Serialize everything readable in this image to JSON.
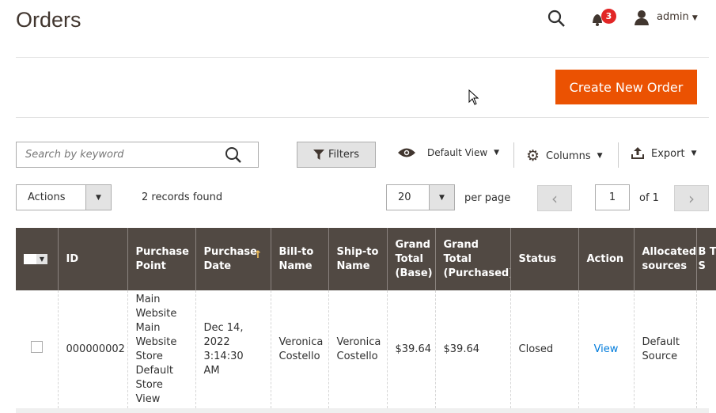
{
  "header": {
    "title": "Orders",
    "notifications_count": "3",
    "user": "admin"
  },
  "actions": {
    "create_order": "Create New Order"
  },
  "toolbar": {
    "search_placeholder": "Search by keyword",
    "filters": "Filters",
    "view": "Default View",
    "columns": "Columns",
    "export": "Export"
  },
  "grid": {
    "actions": "Actions",
    "records": "2 records found",
    "per_page_value": "20",
    "per_page_label": "per page",
    "page": "1",
    "of_pages": "of 1"
  },
  "table": {
    "columns": [
      "ID",
      "Purchase Point",
      "Purchase Date",
      "Bill-to Name",
      "Ship-to Name",
      "Grand Total (Base)",
      "Grand Total (Purchased)",
      "Status",
      "Action",
      "Allocated sources",
      "B T S"
    ],
    "rows": [
      {
        "id": "000000002",
        "purchase_point": "Main Website Main Website Store Default Store View",
        "purchase_date": "Dec 14, 2022 3:14:30 AM",
        "bill_to": "Veronica Costello",
        "ship_to": "Veronica Costello",
        "grand_total_base": "$39.64",
        "grand_total_purchased": "$39.64",
        "status": "Closed",
        "action": "View",
        "allocated_sources": "Default Source"
      }
    ]
  },
  "colors": {
    "accent": "#eb5202",
    "header_bg": "#514943",
    "link": "#007bdb",
    "badge": "#e22626"
  }
}
